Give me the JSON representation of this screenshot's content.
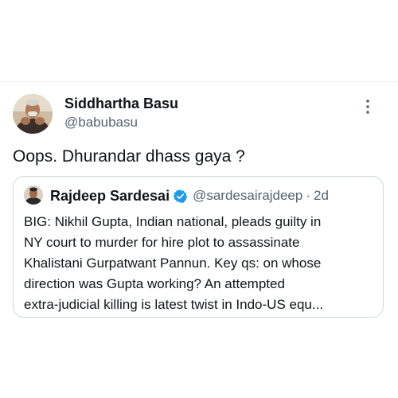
{
  "tweet": {
    "author": {
      "name": "Siddhartha Basu",
      "handle": "@babubasu",
      "avatar_icon": "person-avatar-photo"
    },
    "text": "Oops. Dhurandar dhass gaya ?",
    "more_icon": "more-vertical-icon",
    "quoted": {
      "author_name": "Rajdeep Sardesai",
      "verified": true,
      "verified_color": "#1d9bf0",
      "handle": "@sardesairajdeep",
      "separator": "·",
      "time": "2d",
      "lines": [
        "BIG: Nikhil Gupta, Indian national, pleads guilty in",
        "NY court to murder for hire plot to assassinate",
        "Khalistani Gurpatwant Pannun. Key qs: on whose",
        "direction was Gupta working? An attempted",
        "extra-judicial killing is latest twist in Indo-US equ..."
      ]
    }
  },
  "colors": {
    "text_primary": "#0f1419",
    "text_secondary": "#536471",
    "border": "#cfd9de",
    "divider": "#eff3f4",
    "verified": "#1d9bf0"
  }
}
